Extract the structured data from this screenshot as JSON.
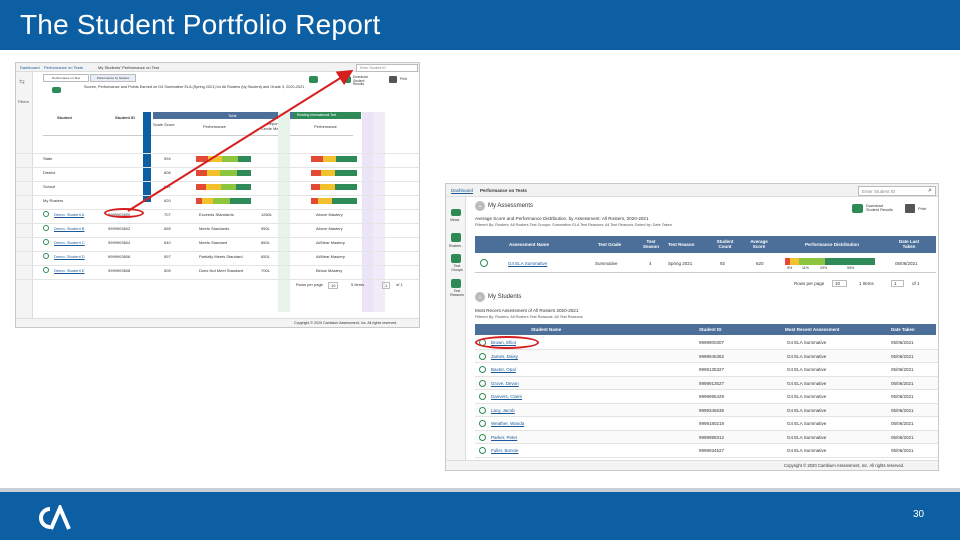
{
  "slide": {
    "title": "The Student Portfolio Report",
    "page_number": "30",
    "logo_text": "CA"
  },
  "colors": {
    "header_blue": "#0d5fa3",
    "table_header_blue": "#4b6f99",
    "annotation_red": "#d61e1e",
    "level_green": "#2e8b57",
    "level_yellow": "#f2c12e",
    "level_red": "#e34a33",
    "level_lightgreen": "#8cc63f"
  },
  "shot1": {
    "breadcrumb": [
      "Dashboard",
      "Performance on Tests",
      "My Students' Performance on Test"
    ],
    "search_placeholder": "Enter Student ID",
    "left_rail_label": "Filters",
    "tabs": [
      "Performance on Test",
      "Performance by Student"
    ],
    "subtitle": "Scores, Performance and Points Earned on G4 Summative ELA (Spring 2021) for All Rosters (by Student) and Grade 3, 2020-2021",
    "buttons": [
      "Show/Hide",
      "Download Student Results",
      "Print"
    ],
    "side_labels": [
      "Reading Informational Text",
      "Reading Literary Text"
    ],
    "columns": [
      "Student",
      "Student ID",
      "Scale Score",
      "Performance",
      "Reported Lexile Measure",
      "Performance"
    ],
    "group_header": "Total",
    "group_header2": "Reading Informational Text",
    "summary_rows": [
      {
        "label": "State",
        "score": "594"
      },
      {
        "label": "District",
        "score": "606"
      },
      {
        "label": "School",
        "score": "601"
      },
      {
        "label": "My Rosters",
        "score": "620"
      }
    ],
    "student_rows": [
      {
        "name": "Demo, Student A",
        "id": "9999903600",
        "score": "707",
        "performance": "Exceeds Standards",
        "lexile": "1260L",
        "perf2": "Above Mastery"
      },
      {
        "name": "Demo, Student B",
        "id": "9999903602",
        "score": "655",
        "performance": "Meets Standards",
        "lexile": "950L",
        "perf2": "Above Mastery"
      },
      {
        "name": "Demo, Student C",
        "id": "9999903604",
        "score": "640",
        "performance": "Meets Standard",
        "lexile": "850L",
        "perf2": "At/Near Mastery"
      },
      {
        "name": "Demo, Student D",
        "id": "9999903606",
        "score": "597",
        "performance": "Partially Meets Standard",
        "lexile": "650L",
        "perf2": "At/Near Mastery"
      },
      {
        "name": "Demo, Student E",
        "id": "9999903608",
        "score": "505",
        "performance": "Does Not Meet Standard",
        "lexile": "700L",
        "perf2": "Below Mastery"
      }
    ],
    "pagination": {
      "rows_label": "Rows per page",
      "rows_value": "10",
      "items": "5 Items",
      "page": "1",
      "of": "of 1"
    },
    "copyright": "Copyright © 2020 Cambium Assessment, Inc. All rights reserved."
  },
  "shot2": {
    "breadcrumb": [
      "Dashboard",
      "Performance on Tests"
    ],
    "search_placeholder": "Enter Student ID",
    "assessments_title": "My Assessments",
    "assessments_subtitle": "Average Score and Performance Distribution, by Assessment: All Rosters, 2020-2021",
    "assessments_filter": "Filtered By: Rosters: All Rosters  Test Groups: Summative ELA  Test Reasons: All Test Reasons  Sorted by: Date Taken",
    "buttons": [
      "Download Student Results",
      "Print"
    ],
    "left_nav": [
      "Views",
      "Rosters",
      "Test Groups",
      "Test Reasons"
    ],
    "assess_columns": [
      "Assessment Name",
      "Test Grade",
      "Test Season",
      "Test Reason",
      "Student Count",
      "Average Score",
      "Performance Distribution",
      "Date Last Taken"
    ],
    "assessment_row": {
      "name": "G4 ELA Summative",
      "grade": "Summative",
      "season": "4",
      "reason": "Spring 2021",
      "count": "92",
      "avg": "620",
      "dist": [
        "5%",
        "11%",
        "29%",
        "55%"
      ],
      "date": "05/06/2021"
    },
    "pagination": {
      "rows_label": "Rows per page",
      "rows_value": "10",
      "items": "1 Items",
      "page": "1",
      "of": "of 1"
    },
    "students_title": "My Students",
    "students_subtitle": "Most Recent Assessment of All Rosters 2020-2021",
    "students_filter": "Filtered By: Rosters: All Rosters  Test Reasons: All Test Reasons",
    "student_columns": [
      "Student Name",
      "Student ID",
      "Most Recent Assessment",
      "Date Taken"
    ],
    "students": [
      {
        "name": "Brown, Elliot",
        "id": "9999900307",
        "assessment": "G4 ELA Summative",
        "date": "05/06/2021"
      },
      {
        "name": "James, Daisy",
        "id": "9999945362",
        "assessment": "G4 ELA Summative",
        "date": "05/06/2021"
      },
      {
        "name": "Baxter, Opal",
        "id": "9999135327",
        "assessment": "G4 ELA Summative",
        "date": "05/06/2021"
      },
      {
        "name": "Grove, Devon",
        "id": "9999913527",
        "assessment": "G4 ELA Summative",
        "date": "05/06/2021"
      },
      {
        "name": "Danvers, Claire",
        "id": "9999995429",
        "assessment": "G4 ELA Summative",
        "date": "05/06/2021"
      },
      {
        "name": "Lacy, Jacob",
        "id": "9999345636",
        "assessment": "G4 ELA Summative",
        "date": "05/06/2021"
      },
      {
        "name": "Weather, Wanda",
        "id": "9999180219",
        "assessment": "G4 ELA Summative",
        "date": "05/06/2021"
      },
      {
        "name": "Parker, Peter",
        "id": "9999999312",
        "assessment": "G4 ELA Summative",
        "date": "05/06/2021"
      },
      {
        "name": "Fuller, Bonnie",
        "id": "9999934527",
        "assessment": "G4 ELA Summative",
        "date": "05/06/2021"
      }
    ],
    "copyright": "Copyright © 2020 Cambium Assessment, Inc. All rights reserved."
  }
}
